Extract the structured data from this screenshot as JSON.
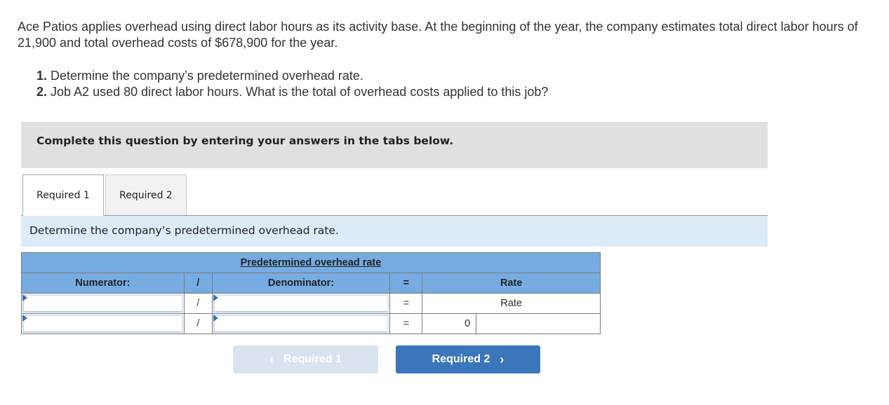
{
  "problem": {
    "intro": "Ace Patios applies overhead using direct labor hours as its activity base. At the beginning of the year, the company estimates total direct labor hours of 21,900 and total overhead costs of $678,900 for the year.",
    "requirements": [
      {
        "num": "1.",
        "text": " Determine the company’s predetermined overhead rate."
      },
      {
        "num": "2.",
        "text": " Job A2 used 80 direct labor hours. What is the total of overhead costs applied to this job?"
      }
    ]
  },
  "banner": "Complete this question by entering your answers in the tabs below.",
  "tabs": [
    {
      "label": "Required 1",
      "active": true
    },
    {
      "label": "Required 2",
      "active": false
    }
  ],
  "instruction": "Determine the company’s predetermined overhead rate.",
  "table": {
    "title": "Predetermined overhead rate",
    "headers": {
      "numerator": "Numerator:",
      "div": "/",
      "denominator": "Denominator:",
      "eq": "=",
      "result": "Rate"
    },
    "rows": [
      {
        "numerator": "",
        "div": "/",
        "denominator": "",
        "eq": "=",
        "result": "Rate",
        "result_value": "",
        "result_unit": ""
      },
      {
        "numerator": "",
        "div": "/",
        "denominator": "",
        "eq": "=",
        "result_value": "0",
        "result_unit": ""
      }
    ]
  },
  "nav": {
    "prev_label": "Required 1",
    "next_label": "Required 2",
    "prev_enabled": false,
    "next_enabled": true
  }
}
